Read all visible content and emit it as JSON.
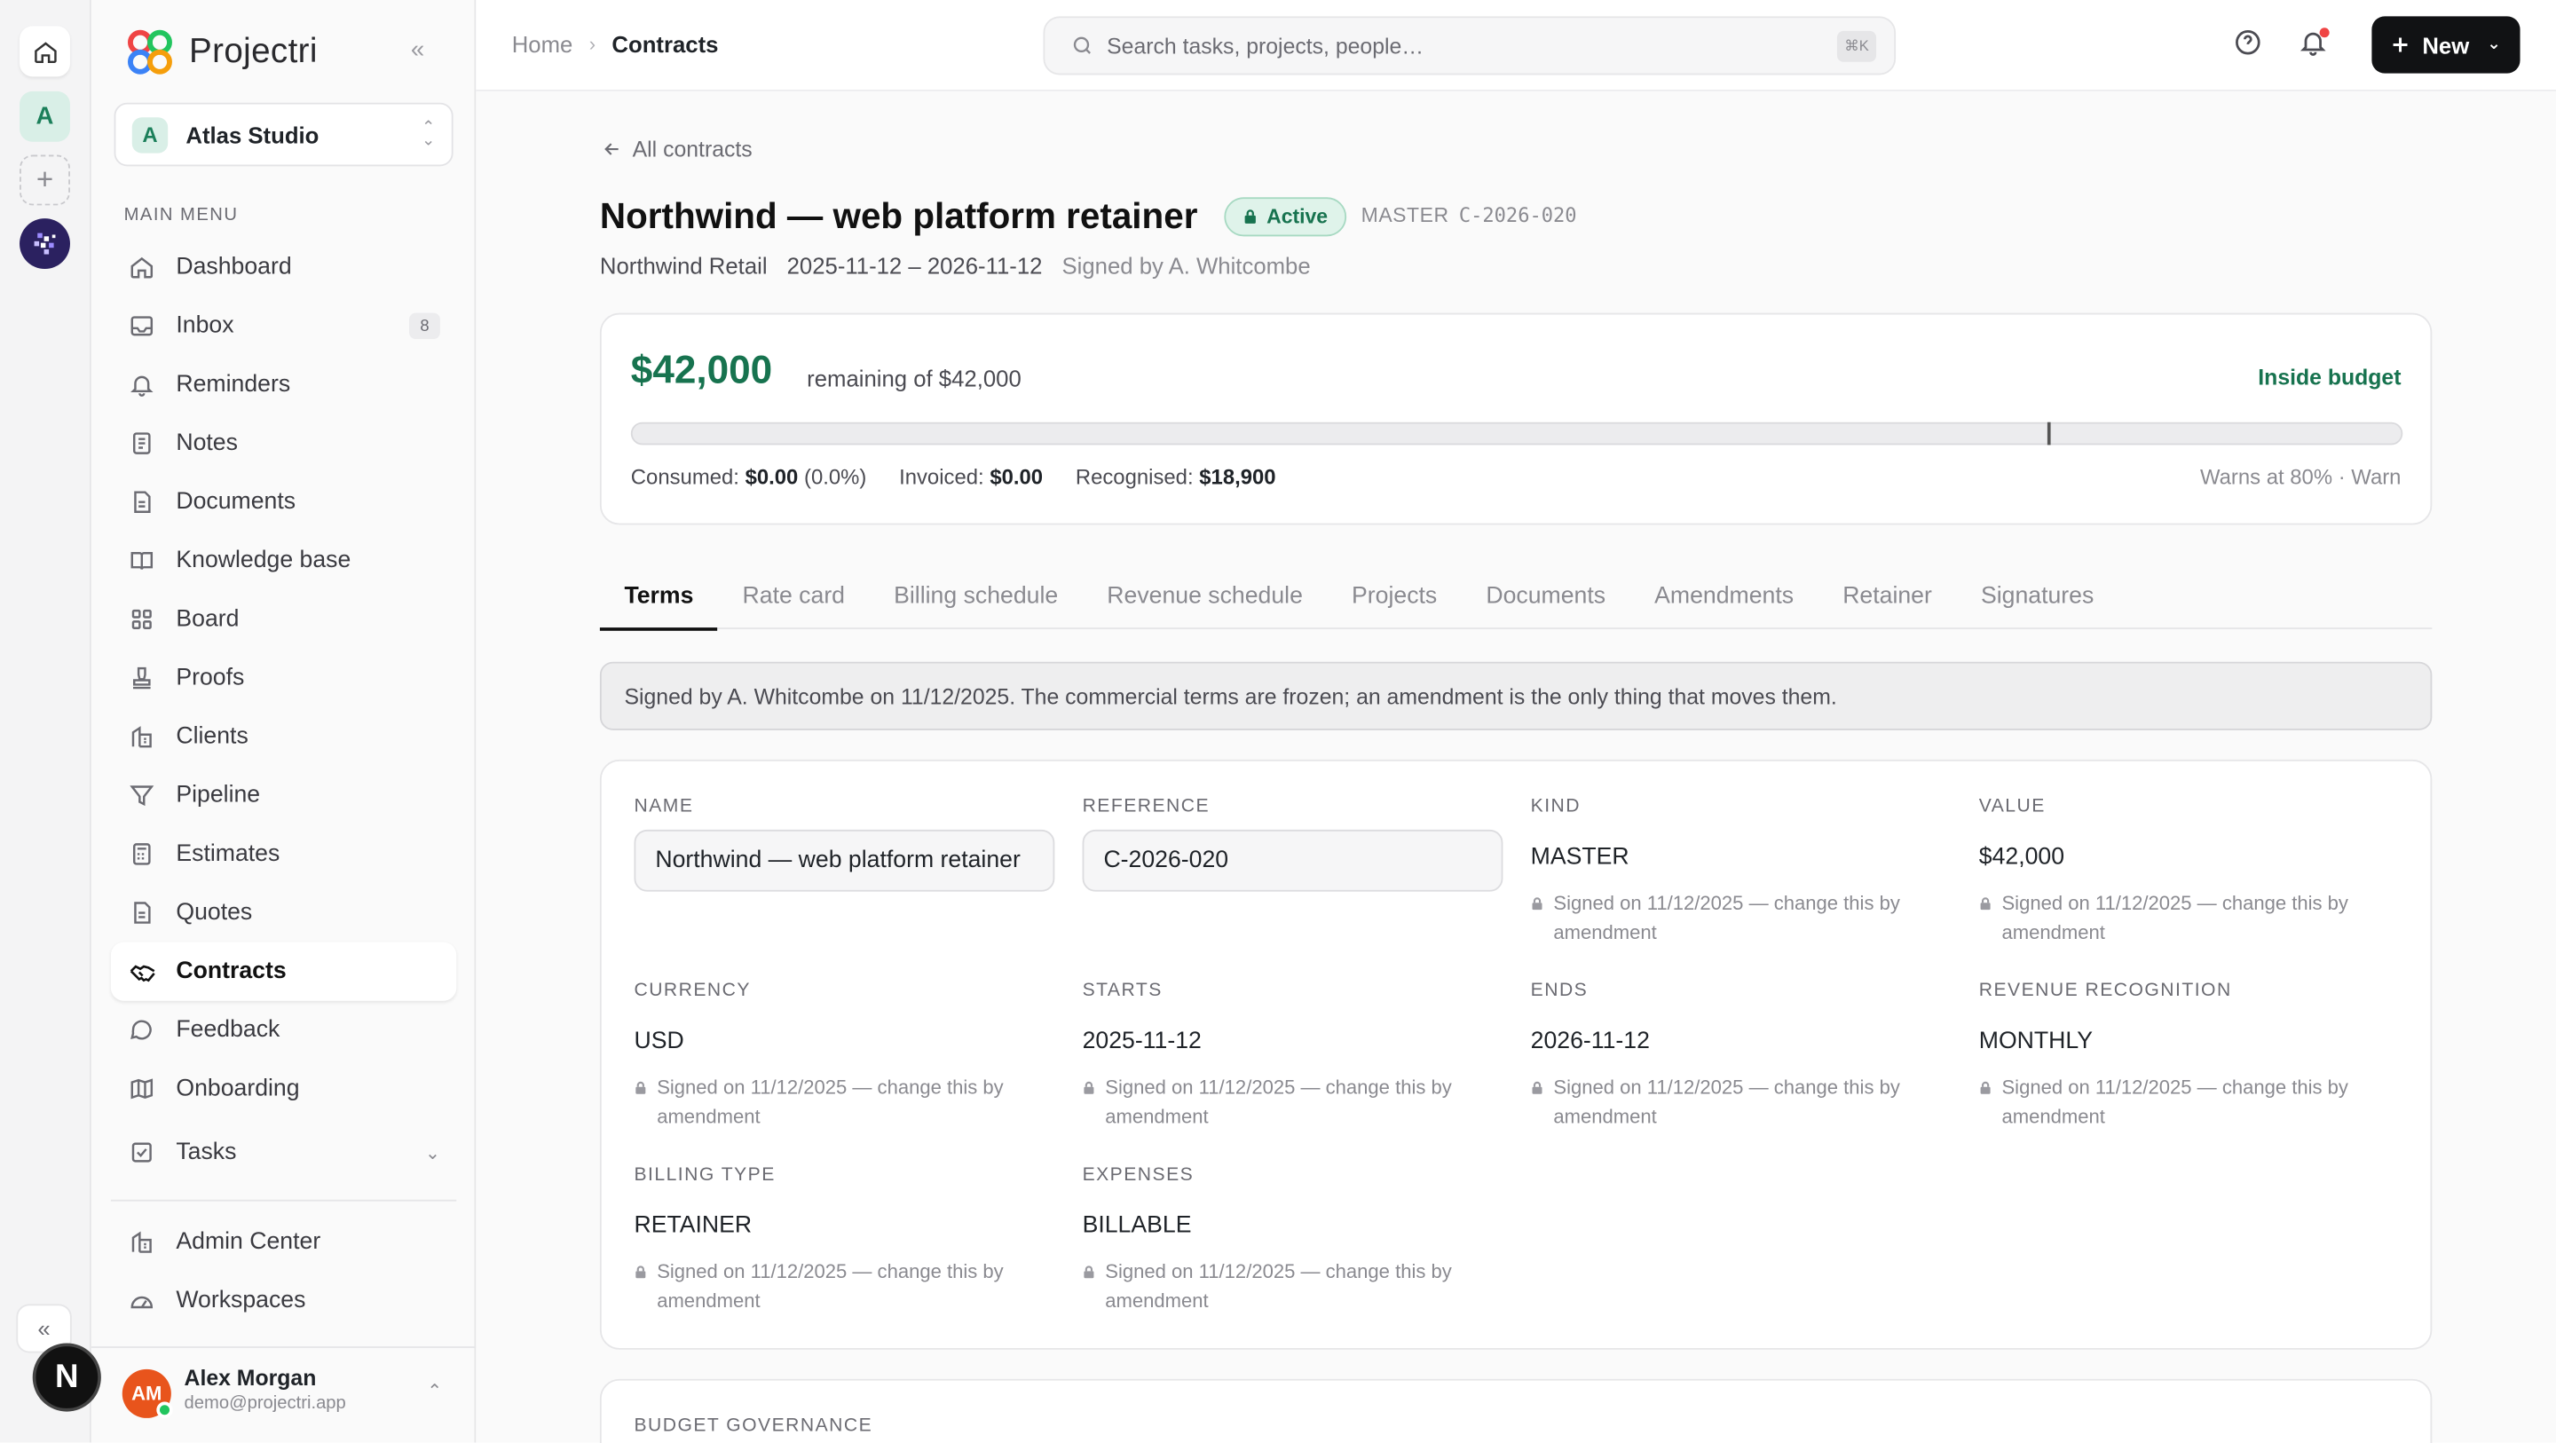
{
  "app": {
    "name": "Projectri"
  },
  "workspace": {
    "initial": "A",
    "name": "Atlas Studio"
  },
  "sidebar": {
    "heading": "MAIN MENU",
    "items": [
      {
        "label": "Dashboard",
        "icon": "home-icon"
      },
      {
        "label": "Inbox",
        "icon": "inbox-icon",
        "count": "8"
      },
      {
        "label": "Reminders",
        "icon": "bell-icon"
      },
      {
        "label": "Notes",
        "icon": "note-icon"
      },
      {
        "label": "Documents",
        "icon": "document-icon"
      },
      {
        "label": "Knowledge base",
        "icon": "book-icon"
      },
      {
        "label": "Board",
        "icon": "grid-icon"
      },
      {
        "label": "Proofs",
        "icon": "stamp-icon"
      },
      {
        "label": "Clients",
        "icon": "building-icon"
      },
      {
        "label": "Pipeline",
        "icon": "funnel-icon"
      },
      {
        "label": "Estimates",
        "icon": "calculator-icon"
      },
      {
        "label": "Quotes",
        "icon": "document-icon"
      },
      {
        "label": "Contracts",
        "icon": "handshake-icon",
        "active": true
      },
      {
        "label": "Feedback",
        "icon": "chat-icon"
      },
      {
        "label": "Onboarding",
        "icon": "map-icon"
      }
    ],
    "tasks_label": "Tasks",
    "admin_items": [
      {
        "label": "Admin Center",
        "icon": "building-icon"
      },
      {
        "label": "Workspaces",
        "icon": "gauge-icon"
      }
    ]
  },
  "user": {
    "initials": "AM",
    "name": "Alex Morgan",
    "email": "demo@projectri.app"
  },
  "header": {
    "breadcrumb_home": "Home",
    "breadcrumb_current": "Contracts",
    "search_placeholder": "Search tasks, projects, people…",
    "search_shortcut": "⌘K",
    "new_label": "New"
  },
  "contract": {
    "back_label": "All contracts",
    "title": "Northwind — web platform retainer",
    "status": "Active",
    "kind": "MASTER",
    "reference": "C-2026-020",
    "client": "Northwind Retail",
    "period": "2025-11-12 – 2026-11-12",
    "signed_by": "Signed by A. Whitcombe"
  },
  "budget": {
    "remaining": "$42,000",
    "remaining_of": "remaining of $42,000",
    "status": "Inside budget",
    "consumed_fraction": 0,
    "warn_threshold_fraction": 0.8,
    "consumed_label": "Consumed:",
    "consumed_value": "$0.00",
    "consumed_pct": "(0.0%)",
    "invoiced_label": "Invoiced:",
    "invoiced_value": "$0.00",
    "recognised_label": "Recognised:",
    "recognised_value": "$18,900",
    "warn_text": "Warns at 80% · Warn"
  },
  "tabs": [
    "Terms",
    "Rate card",
    "Billing schedule",
    "Revenue schedule",
    "Projects",
    "Documents",
    "Amendments",
    "Retainer",
    "Signatures"
  ],
  "notice": "Signed by A. Whitcombe on 11/12/2025. The commercial terms are frozen; an amendment is the only thing that moves them.",
  "terms": {
    "lock_text": "Signed on 11/12/2025 — change this by amendment",
    "name_label": "NAME",
    "name_value": "Northwind — web platform retainer",
    "reference_label": "REFERENCE",
    "reference_value": "C-2026-020",
    "kind_label": "KIND",
    "kind_value": "MASTER",
    "value_label": "VALUE",
    "value_value": "$42,000",
    "currency_label": "CURRENCY",
    "currency_value": "USD",
    "starts_label": "STARTS",
    "starts_value": "2025-11-12",
    "ends_label": "ENDS",
    "ends_value": "2026-11-12",
    "revrec_label": "REVENUE RECOGNITION",
    "revrec_value": "MONTHLY",
    "billing_label": "BILLING TYPE",
    "billing_value": "RETAINER",
    "expenses_label": "EXPENSES",
    "expenses_value": "BILLABLE"
  },
  "governance": {
    "label": "BUDGET GOVERNANCE"
  },
  "colors": {
    "accent": "#17734f",
    "primary_button": "#111214",
    "user_avatar": "#e8541c"
  }
}
